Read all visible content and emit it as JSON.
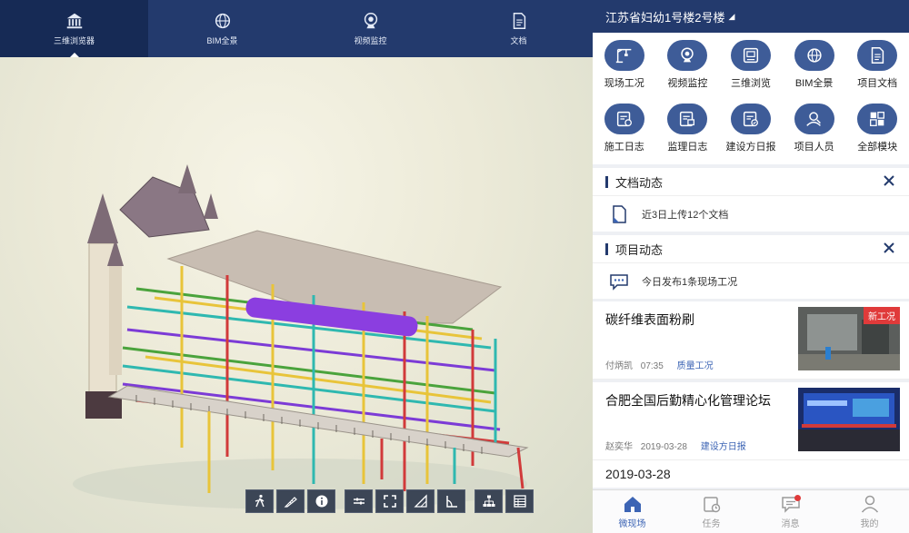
{
  "viewer": {
    "tabs": [
      {
        "label": "三维浏览器",
        "icon": "museum-icon"
      },
      {
        "label": "BIM全景",
        "icon": "panorama-icon"
      },
      {
        "label": "视频监控",
        "icon": "camera-icon"
      },
      {
        "label": "文档",
        "icon": "document-icon"
      }
    ],
    "toolbar": [
      "walk-icon",
      "measure-icon",
      "info-icon",
      "section-icon",
      "fullscreen-icon",
      "area-icon",
      "angle-icon",
      "tree-icon",
      "properties-icon"
    ]
  },
  "panel": {
    "project_title": "江苏省妇幼1号楼2号楼",
    "project_arrow": "◢",
    "grid": [
      {
        "label": "现场工况",
        "icon": "crane-icon"
      },
      {
        "label": "视频监控",
        "icon": "camera-icon"
      },
      {
        "label": "三维浏览",
        "icon": "3d-view-icon"
      },
      {
        "label": "BIM全景",
        "icon": "panorama-icon"
      },
      {
        "label": "项目文档",
        "icon": "document-icon"
      },
      {
        "label": "施工日志",
        "icon": "construction-log-icon"
      },
      {
        "label": "监理日志",
        "icon": "supervision-log-icon"
      },
      {
        "label": "建设方日报",
        "icon": "daily-report-icon"
      },
      {
        "label": "项目人员",
        "icon": "people-icon"
      },
      {
        "label": "全部模块",
        "icon": "all-modules-icon"
      }
    ],
    "doc_card": {
      "title": "文档动态",
      "text": "近3日上传12个文档"
    },
    "proj_card": {
      "title": "项目动态",
      "text": "今日发布1条现场工况"
    },
    "news": [
      {
        "title": "碳纤维表面粉刷",
        "author": "付炳凯",
        "time": "07:35",
        "tag": "质量工况",
        "badge": "新工况"
      },
      {
        "title": "合肥全国后勤精心化管理论坛",
        "author": "赵奕华",
        "time": "2019-03-28",
        "tag": "建设方日报"
      }
    ],
    "date_header": "2019-03-28",
    "tabbar": [
      {
        "label": "微现场",
        "icon": "home-icon",
        "active": true
      },
      {
        "label": "任务",
        "icon": "task-icon"
      },
      {
        "label": "消息",
        "icon": "message-icon"
      },
      {
        "label": "我的",
        "icon": "profile-icon"
      }
    ],
    "colors": {
      "navy": "#233a6d",
      "accent": "#3c64b4",
      "icon_bg": "#3e5c98",
      "badge": "#e03a3a"
    }
  }
}
